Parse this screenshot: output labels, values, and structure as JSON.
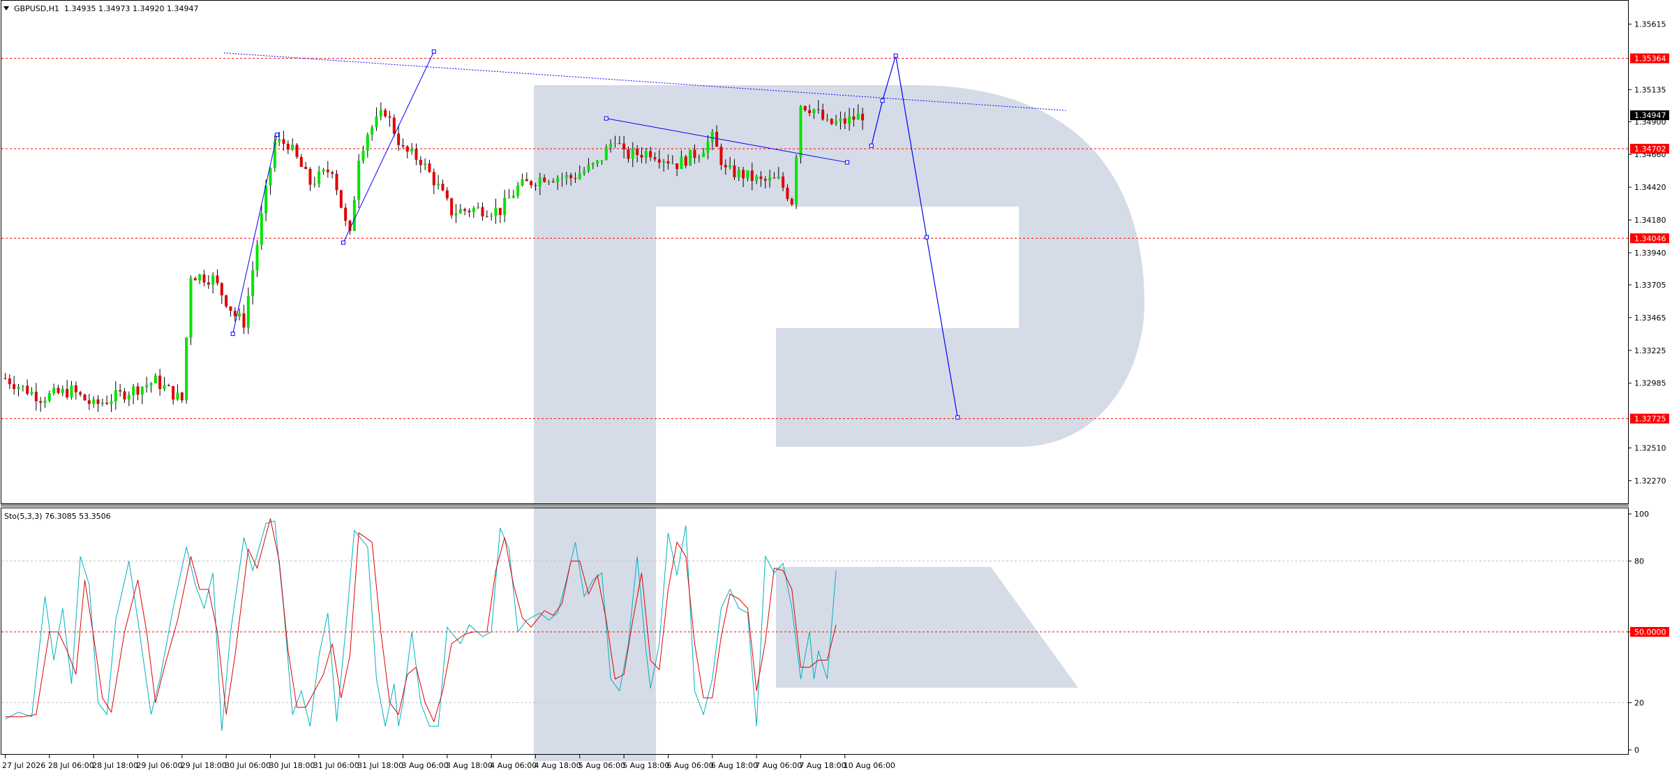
{
  "header": {
    "symbol": "GBPUSD,H1",
    "ohlc": "1.34935 1.34973 1.34920 1.34947"
  },
  "indicator": {
    "label": "Sto(5,3,3) 76.3085 53.3506"
  },
  "colors": {
    "bull": "#00e400",
    "bear": "#e00000",
    "wick": "#000000",
    "level_line": "#ff0000",
    "forecast": "#0000ff",
    "stoch_main": "#00b0c0",
    "stoch_signal": "#e00000",
    "watermark": "#d5dce7",
    "current_price_bg": "#000000"
  },
  "chart_data": [
    {
      "type": "candlestick",
      "symbol": "GBPUSD",
      "timeframe": "H1",
      "ylim": [
        1.3215,
        1.3573
      ],
      "y_ticks": [
        "1.35615",
        "1.35135",
        "1.34900",
        "1.34660",
        "1.34420",
        "1.34180",
        "1.33940",
        "1.33705",
        "1.33465",
        "1.33225",
        "1.32985",
        "1.32510",
        "1.32270"
      ],
      "x_ticks": [
        "27 Jul 2026",
        "28 Jul 06:00",
        "28 Jul 18:00",
        "29 Jul 06:00",
        "29 Jul 18:00",
        "30 Jul 06:00",
        "30 Jul 18:00",
        "31 Jul 06:00",
        "31 Jul 18:00",
        "3 Aug 06:00",
        "3 Aug 18:00",
        "4 Aug 06:00",
        "4 Aug 18:00",
        "5 Aug 06:00",
        "5 Aug 18:00",
        "6 Aug 06:00",
        "6 Aug 18:00",
        "7 Aug 06:00",
        "7 Aug 18:00",
        "10 Aug 06:00"
      ],
      "x_tick_index": [
        0,
        10,
        20,
        30,
        40,
        50,
        60,
        70,
        80,
        90,
        100,
        110,
        120,
        130,
        140,
        150,
        160,
        170,
        180,
        190
      ],
      "levels": [
        {
          "value": 1.35364,
          "label": "1.35364"
        },
        {
          "value": 1.34702,
          "label": "1.34702"
        },
        {
          "value": 1.34046,
          "label": "1.34046"
        },
        {
          "value": 1.32725,
          "label": "1.32725"
        }
      ],
      "current_price": {
        "value": 1.34947,
        "label": "1.34947"
      },
      "close_anchors": [
        [
          0,
          1.3302
        ],
        [
          8,
          1.3288
        ],
        [
          15,
          1.3293
        ],
        [
          20,
          1.3282
        ],
        [
          26,
          1.329
        ],
        [
          34,
          1.33
        ],
        [
          40,
          1.3286
        ],
        [
          42,
          1.3378
        ],
        [
          47,
          1.3375
        ],
        [
          52,
          1.3348
        ],
        [
          54,
          1.3343
        ],
        [
          58,
          1.342
        ],
        [
          61,
          1.3475
        ],
        [
          64,
          1.3474
        ],
        [
          69,
          1.3445
        ],
        [
          74,
          1.3456
        ],
        [
          77,
          1.3415
        ],
        [
          78,
          1.3406
        ],
        [
          80,
          1.3465
        ],
        [
          82,
          1.3482
        ],
        [
          86,
          1.3498
        ],
        [
          90,
          1.3469
        ],
        [
          94,
          1.3462
        ],
        [
          98,
          1.3442
        ],
        [
          101,
          1.3424
        ],
        [
          106,
          1.3426
        ],
        [
          112,
          1.3425
        ],
        [
          116,
          1.3442
        ],
        [
          122,
          1.345
        ],
        [
          128,
          1.3449
        ],
        [
          134,
          1.3459
        ],
        [
          138,
          1.3479
        ],
        [
          140,
          1.3465
        ],
        [
          146,
          1.3468
        ],
        [
          152,
          1.3459
        ],
        [
          157,
          1.3468
        ],
        [
          160,
          1.3478
        ],
        [
          163,
          1.3454
        ],
        [
          167,
          1.3451
        ],
        [
          171,
          1.3446
        ],
        [
          175,
          1.3447
        ],
        [
          178,
          1.3432
        ],
        [
          180,
          1.3503
        ],
        [
          183,
          1.3499
        ],
        [
          186,
          1.3488
        ],
        [
          190,
          1.349
        ],
        [
          194,
          1.3495
        ]
      ],
      "trendlines": [
        {
          "from": [
            49.5,
            1.35404
          ],
          "to": [
            240,
            1.34982
          ],
          "style": "dotted"
        },
        {
          "from": [
            51.5,
            1.33346
          ],
          "to": [
            61.5,
            1.34804
          ],
          "style": "solid"
        },
        {
          "from": [
            76.5,
            1.34014
          ],
          "to": [
            97,
            1.35414
          ],
          "style": "solid"
        },
        {
          "from": [
            136,
            1.34924
          ],
          "to": [
            190.5,
            1.34602
          ],
          "style": "solid"
        }
      ],
      "forecast_path": [
        [
          196,
          1.34724
        ],
        [
          198.5,
          1.35054
        ],
        [
          201.5,
          1.35384
        ],
        [
          208.5,
          1.34054
        ],
        [
          215.5,
          1.32734
        ]
      ]
    },
    {
      "type": "line",
      "indicator": "Sto(5,3,3)",
      "ylim": [
        0,
        100
      ],
      "y_ticks": [
        "100",
        "80",
        "50.0000",
        "20",
        "0"
      ],
      "levels": [
        80,
        50,
        20
      ],
      "series": [
        {
          "name": "main",
          "anchors": [
            [
              0,
              13
            ],
            [
              3,
              16
            ],
            [
              6,
              14
            ],
            [
              9,
              65
            ],
            [
              11,
              38
            ],
            [
              13,
              60
            ],
            [
              15,
              28
            ],
            [
              17,
              82
            ],
            [
              19,
              70
            ],
            [
              21,
              20
            ],
            [
              23,
              15
            ],
            [
              25,
              55
            ],
            [
              28,
              80
            ],
            [
              30,
              55
            ],
            [
              33,
              15
            ],
            [
              35,
              30
            ],
            [
              38,
              60
            ],
            [
              41,
              86
            ],
            [
              43,
              70
            ],
            [
              45,
              60
            ],
            [
              47,
              75
            ],
            [
              49,
              8
            ],
            [
              51,
              50
            ],
            [
              54,
              90
            ],
            [
              56,
              76
            ],
            [
              59,
              96
            ],
            [
              61,
              97
            ],
            [
              63,
              60
            ],
            [
              65,
              15
            ],
            [
              67,
              25
            ],
            [
              69,
              10
            ],
            [
              71,
              40
            ],
            [
              73,
              58
            ],
            [
              75,
              12
            ],
            [
              77,
              50
            ],
            [
              79,
              93
            ],
            [
              82,
              86
            ],
            [
              84,
              30
            ],
            [
              86,
              10
            ],
            [
              88,
              28
            ],
            [
              89,
              10
            ],
            [
              90,
              20
            ],
            [
              92,
              50
            ],
            [
              94,
              20
            ],
            [
              96,
              10
            ],
            [
              98,
              10
            ],
            [
              100,
              52
            ],
            [
              103,
              45
            ],
            [
              105,
              53
            ],
            [
              108,
              48
            ],
            [
              110,
              50
            ],
            [
              112,
              94
            ],
            [
              114,
              85
            ],
            [
              116,
              50
            ],
            [
              118,
              55
            ],
            [
              121,
              58
            ],
            [
              123,
              55
            ],
            [
              125,
              58
            ],
            [
              127,
              72
            ],
            [
              129,
              88
            ],
            [
              131,
              65
            ],
            [
              133,
              72
            ],
            [
              135,
              75
            ],
            [
              137,
              30
            ],
            [
              139,
              25
            ],
            [
              141,
              45
            ],
            [
              143,
              82
            ],
            [
              145,
              42
            ],
            [
              146,
              26
            ],
            [
              148,
              45
            ],
            [
              150,
              92
            ],
            [
              152,
              74
            ],
            [
              154,
              95
            ],
            [
              156,
              25
            ],
            [
              158,
              15
            ],
            [
              160,
              30
            ],
            [
              162,
              60
            ],
            [
              164,
              68
            ],
            [
              166,
              60
            ],
            [
              168,
              58
            ],
            [
              170,
              10
            ],
            [
              172,
              82
            ],
            [
              174,
              75
            ],
            [
              176,
              79
            ],
            [
              178,
              60
            ],
            [
              180,
              30
            ],
            [
              182,
              50
            ],
            [
              183,
              30
            ],
            [
              184,
              42
            ],
            [
              186,
              30
            ],
            [
              188,
              76
            ]
          ]
        },
        {
          "name": "signal",
          "anchors": [
            [
              0,
              14
            ],
            [
              4,
              14
            ],
            [
              7,
              15
            ],
            [
              10,
              50
            ],
            [
              12,
              50
            ],
            [
              14,
              42
            ],
            [
              16,
              32
            ],
            [
              18,
              72
            ],
            [
              20,
              48
            ],
            [
              22,
              22
            ],
            [
              24,
              16
            ],
            [
              27,
              50
            ],
            [
              30,
              72
            ],
            [
              32,
              50
            ],
            [
              34,
              20
            ],
            [
              36,
              35
            ],
            [
              39,
              55
            ],
            [
              42,
              82
            ],
            [
              44,
              68
            ],
            [
              46,
              68
            ],
            [
              48,
              50
            ],
            [
              50,
              15
            ],
            [
              52,
              40
            ],
            [
              55,
              85
            ],
            [
              57,
              77
            ],
            [
              60,
              98
            ],
            [
              62,
              80
            ],
            [
              64,
              42
            ],
            [
              66,
              18
            ],
            [
              68,
              18
            ],
            [
              70,
              25
            ],
            [
              72,
              32
            ],
            [
              74,
              45
            ],
            [
              76,
              22
            ],
            [
              78,
              40
            ],
            [
              80,
              92
            ],
            [
              83,
              88
            ],
            [
              85,
              50
            ],
            [
              87,
              20
            ],
            [
              89,
              15
            ],
            [
              91,
              32
            ],
            [
              93,
              35
            ],
            [
              95,
              20
            ],
            [
              97,
              12
            ],
            [
              99,
              25
            ],
            [
              101,
              45
            ],
            [
              104,
              49
            ],
            [
              106,
              50
            ],
            [
              109,
              50
            ],
            [
              111,
              76
            ],
            [
              113,
              90
            ],
            [
              115,
              70
            ],
            [
              117,
              56
            ],
            [
              119,
              52
            ],
            [
              122,
              59
            ],
            [
              124,
              57
            ],
            [
              126,
              62
            ],
            [
              128,
              80
            ],
            [
              130,
              80
            ],
            [
              132,
              66
            ],
            [
              134,
              74
            ],
            [
              136,
              55
            ],
            [
              138,
              30
            ],
            [
              140,
              32
            ],
            [
              142,
              55
            ],
            [
              144,
              75
            ],
            [
              146,
              38
            ],
            [
              148,
              34
            ],
            [
              150,
              68
            ],
            [
              152,
              88
            ],
            [
              154,
              82
            ],
            [
              156,
              45
            ],
            [
              158,
              22
            ],
            [
              160,
              22
            ],
            [
              162,
              48
            ],
            [
              164,
              66
            ],
            [
              166,
              64
            ],
            [
              168,
              60
            ],
            [
              170,
              25
            ],
            [
              172,
              46
            ],
            [
              174,
              77
            ],
            [
              176,
              76
            ],
            [
              178,
              68
            ],
            [
              180,
              35
            ],
            [
              182,
              35
            ],
            [
              184,
              38
            ],
            [
              186,
              38
            ],
            [
              188,
              53
            ]
          ]
        }
      ]
    }
  ]
}
